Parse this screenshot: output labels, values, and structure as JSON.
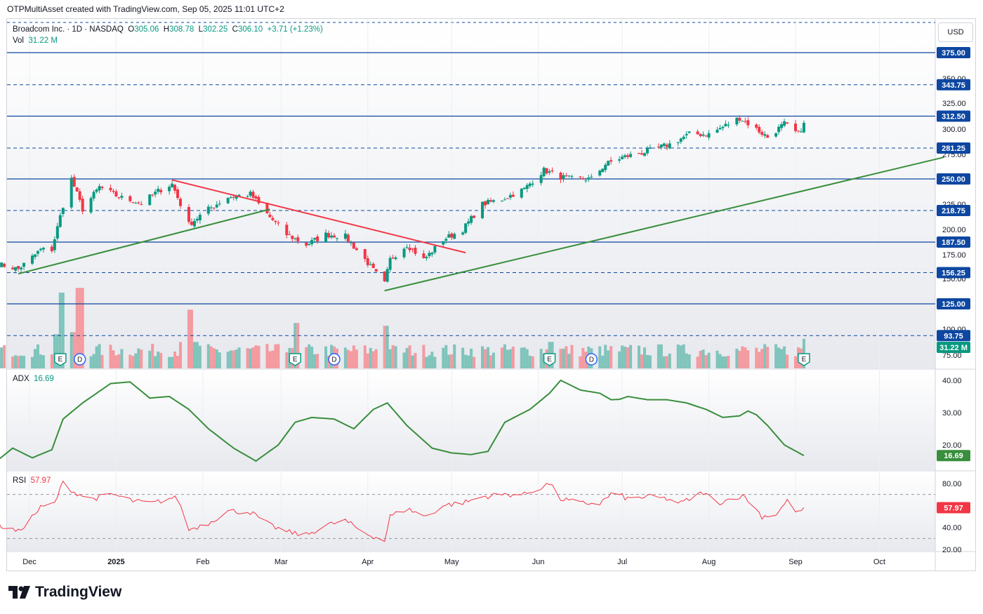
{
  "header": {
    "attribution": "OTPMultiAsset created with TradingView.com, Sep 05, 2025 11:01 UTC+2"
  },
  "legend": {
    "symbol_line": "Broadcom Inc. · 1D · NASDAQ",
    "o_label": "O",
    "o_value": "305.06",
    "h_label": "H",
    "h_value": "308.78",
    "l_label": "L",
    "l_value": "302.25",
    "c_label": "C",
    "c_value": "306.10",
    "change": "+3.71 (+1.23%)",
    "vol_label": "Vol",
    "vol_value": "31.22 M",
    "adx_label": "ADX",
    "adx_value": "16.69",
    "rsi_label": "RSI",
    "rsi_value": "57.97"
  },
  "currency": "USD",
  "branding": {
    "logo_text": "TradingView"
  },
  "colors": {
    "up": "#089981",
    "down": "#f23645",
    "level_line": "#0d47a1",
    "trend_green": "#388e3c",
    "trend_red": "#f23645",
    "adx_line": "#388e3c",
    "rsi_line": "#f23645",
    "vol_up": "#7fc4bb",
    "vol_down": "#f49aa0"
  },
  "chart_data": [
    {
      "type": "candlestick",
      "title": "Broadcom Inc. · 1D · NASDAQ",
      "ylim": [
        70,
        395
      ],
      "y_ticks": [
        75,
        100,
        150,
        175,
        200,
        225,
        250,
        275,
        300,
        325,
        350
      ],
      "x_tick_labels": [
        "Dec",
        "2025",
        "Feb",
        "Mar",
        "Apr",
        "May",
        "Jun",
        "Jul",
        "Aug",
        "Sep",
        "Oct"
      ],
      "x_tick_positions_days": [
        0,
        31,
        62,
        90,
        121,
        151,
        182,
        212,
        243,
        274,
        304
      ],
      "horizontal_levels": [
        {
          "value": 375.0,
          "style": "solid",
          "label": "375.00"
        },
        {
          "value": 343.75,
          "style": "dashed",
          "label": "343.75"
        },
        {
          "value": 312.5,
          "style": "solid",
          "label": "312.50"
        },
        {
          "value": 281.25,
          "style": "dashed",
          "label": "281.25"
        },
        {
          "value": 250.0,
          "style": "solid",
          "label": "250.00"
        },
        {
          "value": 218.75,
          "style": "dashed",
          "label": "218.75"
        },
        {
          "value": 187.5,
          "style": "solid",
          "label": "187.50"
        },
        {
          "value": 156.25,
          "style": "dashed",
          "label": "156.25"
        },
        {
          "value": 125.0,
          "style": "solid",
          "label": "125.00"
        },
        {
          "value": 93.75,
          "style": "dashed",
          "label": "93.75"
        }
      ],
      "trendlines": [
        {
          "color": "green",
          "points": [
            [
              "2024-11-27",
              155
            ],
            [
              "2025-02-25",
              220
            ]
          ]
        },
        {
          "color": "red",
          "points": [
            [
              "2025-01-21",
              249
            ],
            [
              "2025-05-06",
              177
            ]
          ]
        },
        {
          "color": "green",
          "points": [
            [
              "2025-04-07",
              138
            ],
            [
              "2025-10-24",
              272
            ]
          ]
        }
      ],
      "close_series_anchors": [
        [
          "2024-11-20",
          165
        ],
        [
          "2024-11-27",
          160
        ],
        [
          "2024-12-05",
          180
        ],
        [
          "2024-12-09",
          180
        ],
        [
          "2024-12-13",
          224
        ],
        [
          "2024-12-16",
          250
        ],
        [
          "2024-12-20",
          220
        ],
        [
          "2024-12-26",
          242
        ],
        [
          "2025-01-02",
          232
        ],
        [
          "2025-01-10",
          226
        ],
        [
          "2025-01-16",
          238
        ],
        [
          "2025-01-21",
          245
        ],
        [
          "2025-01-27",
          205
        ],
        [
          "2025-02-03",
          220
        ],
        [
          "2025-02-10",
          232
        ],
        [
          "2025-02-18",
          235
        ],
        [
          "2025-02-25",
          212
        ],
        [
          "2025-03-03",
          195
        ],
        [
          "2025-03-10",
          185
        ],
        [
          "2025-03-17",
          195
        ],
        [
          "2025-03-24",
          193
        ],
        [
          "2025-03-31",
          170
        ],
        [
          "2025-04-04",
          155
        ],
        [
          "2025-04-07",
          145
        ],
        [
          "2025-04-09",
          170
        ],
        [
          "2025-04-15",
          185
        ],
        [
          "2025-04-21",
          170
        ],
        [
          "2025-04-28",
          190
        ],
        [
          "2025-05-05",
          200
        ],
        [
          "2025-05-12",
          225
        ],
        [
          "2025-05-19",
          230
        ],
        [
          "2025-05-27",
          240
        ],
        [
          "2025-06-03",
          259
        ],
        [
          "2025-06-09",
          252
        ],
        [
          "2025-06-13",
          250
        ],
        [
          "2025-06-20",
          250
        ],
        [
          "2025-06-25",
          265
        ],
        [
          "2025-07-01",
          272
        ],
        [
          "2025-07-10",
          278
        ],
        [
          "2025-07-18",
          285
        ],
        [
          "2025-07-25",
          295
        ],
        [
          "2025-08-01",
          295
        ],
        [
          "2025-08-08",
          305
        ],
        [
          "2025-08-12",
          311
        ],
        [
          "2025-08-18",
          300
        ],
        [
          "2025-08-22",
          292
        ],
        [
          "2025-08-28",
          305
        ],
        [
          "2025-09-02",
          295
        ],
        [
          "2025-09-04",
          306
        ]
      ],
      "volume_spikes": [
        [
          "2024-12-13",
          80
        ],
        [
          "2024-12-19",
          85
        ],
        [
          "2025-01-27",
          62
        ],
        [
          "2025-03-07",
          48
        ],
        [
          "2025-04-07",
          45
        ],
        [
          "2025-06-06",
          28
        ],
        [
          "2025-09-05",
          31.22
        ]
      ],
      "volume_last": "31.22 M",
      "event_markers": [
        {
          "date": "2024-12-12",
          "label": "E"
        },
        {
          "date": "2024-12-19",
          "label": "D"
        },
        {
          "date": "2025-03-06",
          "label": "E"
        },
        {
          "date": "2025-03-20",
          "label": "D"
        },
        {
          "date": "2025-06-05",
          "label": "E"
        },
        {
          "date": "2025-06-20",
          "label": "D"
        },
        {
          "date": "2025-09-04",
          "label": "E"
        }
      ]
    },
    {
      "type": "line",
      "title": "ADX",
      "last_value": 16.69,
      "y_ticks": [
        20,
        30,
        40
      ],
      "ylim": [
        12,
        43
      ],
      "anchors": [
        [
          "2024-11-20",
          15.5
        ],
        [
          "2024-11-25",
          19
        ],
        [
          "2024-12-02",
          16
        ],
        [
          "2024-12-09",
          18.5
        ],
        [
          "2024-12-13",
          28
        ],
        [
          "2024-12-20",
          33
        ],
        [
          "2024-12-30",
          39
        ],
        [
          "2025-01-06",
          39.5
        ],
        [
          "2025-01-13",
          34.5
        ],
        [
          "2025-01-20",
          35
        ],
        [
          "2025-01-27",
          31
        ],
        [
          "2025-02-03",
          25
        ],
        [
          "2025-02-12",
          19
        ],
        [
          "2025-02-20",
          15
        ],
        [
          "2025-02-28",
          20
        ],
        [
          "2025-03-06",
          27
        ],
        [
          "2025-03-12",
          28.5
        ],
        [
          "2025-03-20",
          28
        ],
        [
          "2025-03-27",
          25
        ],
        [
          "2025-04-03",
          31
        ],
        [
          "2025-04-08",
          33
        ],
        [
          "2025-04-15",
          26
        ],
        [
          "2025-04-24",
          19
        ],
        [
          "2025-05-01",
          17.5
        ],
        [
          "2025-05-08",
          17
        ],
        [
          "2025-05-14",
          18
        ],
        [
          "2025-05-20",
          27
        ],
        [
          "2025-05-29",
          31
        ],
        [
          "2025-06-05",
          36
        ],
        [
          "2025-06-09",
          40
        ],
        [
          "2025-06-16",
          37
        ],
        [
          "2025-06-23",
          36
        ],
        [
          "2025-06-28",
          33.5
        ],
        [
          "2025-07-03",
          35
        ],
        [
          "2025-07-10",
          34
        ],
        [
          "2025-07-17",
          34
        ],
        [
          "2025-07-24",
          33
        ],
        [
          "2025-07-31",
          31
        ],
        [
          "2025-08-06",
          28.5
        ],
        [
          "2025-08-12",
          29
        ],
        [
          "2025-08-16",
          31
        ],
        [
          "2025-08-22",
          26
        ],
        [
          "2025-08-28",
          20
        ],
        [
          "2025-09-04",
          16.69
        ]
      ]
    },
    {
      "type": "line",
      "title": "RSI",
      "last_value": 57.97,
      "y_ticks": [
        20.0,
        40.0,
        80.0
      ],
      "ylim": [
        15,
        92
      ],
      "band_lines": [
        30,
        70
      ],
      "anchors": [
        [
          "2024-11-20",
          42
        ],
        [
          "2024-11-27",
          36
        ],
        [
          "2024-12-05",
          58
        ],
        [
          "2024-12-10",
          62
        ],
        [
          "2024-12-13",
          81
        ],
        [
          "2024-12-17",
          72
        ],
        [
          "2024-12-23",
          66
        ],
        [
          "2024-12-31",
          70
        ],
        [
          "2025-01-07",
          64
        ],
        [
          "2025-01-14",
          62
        ],
        [
          "2025-01-21",
          67
        ],
        [
          "2025-01-23",
          66
        ],
        [
          "2025-01-27",
          38
        ],
        [
          "2025-02-03",
          44
        ],
        [
          "2025-02-10",
          55
        ],
        [
          "2025-02-18",
          54
        ],
        [
          "2025-02-25",
          42
        ],
        [
          "2025-03-03",
          36
        ],
        [
          "2025-03-10",
          33
        ],
        [
          "2025-03-17",
          42
        ],
        [
          "2025-03-24",
          46
        ],
        [
          "2025-03-31",
          35
        ],
        [
          "2025-04-07",
          28
        ],
        [
          "2025-04-09",
          50
        ],
        [
          "2025-04-15",
          57
        ],
        [
          "2025-04-22",
          50
        ],
        [
          "2025-04-28",
          60
        ],
        [
          "2025-05-06",
          63
        ],
        [
          "2025-05-12",
          68
        ],
        [
          "2025-05-20",
          70
        ],
        [
          "2025-05-27",
          70
        ],
        [
          "2025-06-05",
          80
        ],
        [
          "2025-06-09",
          66
        ],
        [
          "2025-06-16",
          62
        ],
        [
          "2025-06-23",
          62
        ],
        [
          "2025-06-28",
          72
        ],
        [
          "2025-07-03",
          66
        ],
        [
          "2025-07-10",
          68
        ],
        [
          "2025-07-17",
          66
        ],
        [
          "2025-07-22",
          62
        ],
        [
          "2025-07-30",
          72
        ],
        [
          "2025-08-04",
          62
        ],
        [
          "2025-08-11",
          68
        ],
        [
          "2025-08-14",
          68
        ],
        [
          "2025-08-20",
          50
        ],
        [
          "2025-08-25",
          52
        ],
        [
          "2025-08-29",
          64
        ],
        [
          "2025-09-02",
          53
        ],
        [
          "2025-09-04",
          57.97
        ]
      ]
    }
  ]
}
